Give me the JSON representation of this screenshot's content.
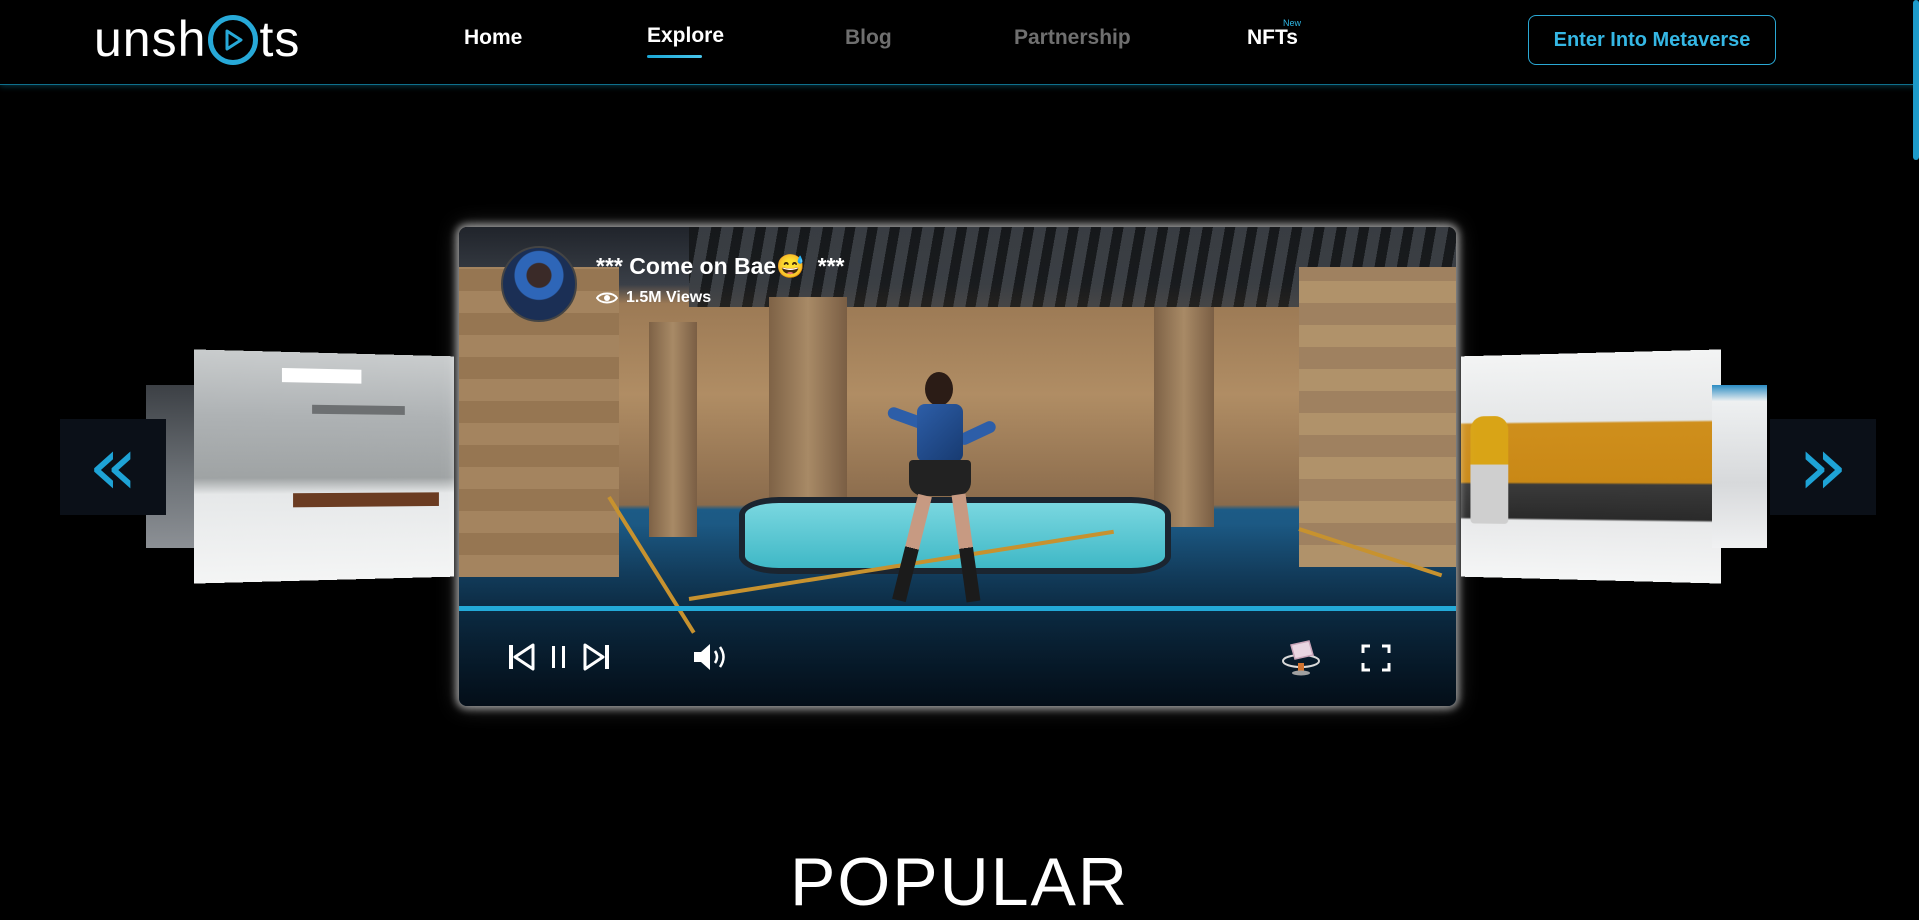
{
  "nav": {
    "logo_prefix": "unsh",
    "logo_suffix": "ts",
    "items": [
      {
        "label": "Home"
      },
      {
        "label": "Explore"
      },
      {
        "label": "Blog"
      },
      {
        "label": "Partnership"
      },
      {
        "label": "NFTs",
        "badge": "New"
      }
    ],
    "active": "Explore",
    "cta": "Enter Into Metaverse"
  },
  "carousel": {
    "prev_arrow": "«",
    "next_arrow": "»"
  },
  "video": {
    "title": "*** Come on Bae😅  ***",
    "views": "1.5M Views",
    "progress": 1.0,
    "icons": [
      "eye-icon",
      "previous-icon",
      "pause-icon",
      "next-icon",
      "volume-icon",
      "vr-icon",
      "fullscreen-icon"
    ]
  },
  "section": {
    "heading": "POPULAR"
  },
  "colors": {
    "accent": "#23aad8",
    "background": "#000000",
    "inactive_nav": "#6f6f6f"
  }
}
